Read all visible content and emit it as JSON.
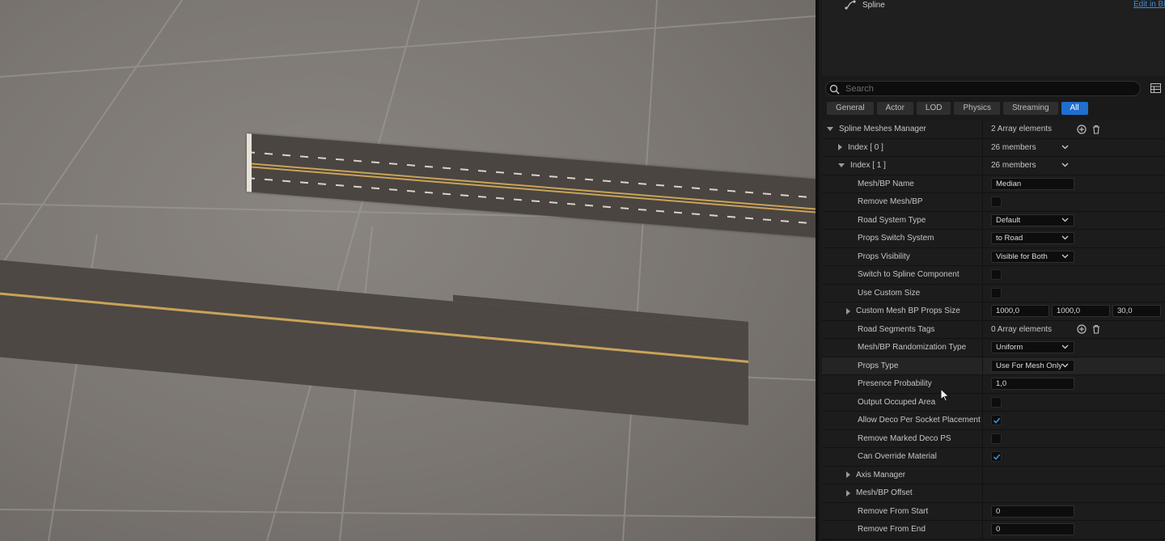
{
  "component": {
    "name": "Spline",
    "edit_link": "Edit in Blu"
  },
  "search": {
    "placeholder": "Search"
  },
  "tabs": [
    "General",
    "Actor",
    "LOD",
    "Physics",
    "Streaming",
    "All"
  ],
  "active_tab": "All",
  "rows": {
    "manager": {
      "label": "Spline Meshes Manager",
      "value": "2 Array elements"
    },
    "index0": {
      "label": "Index [ 0 ]",
      "value": "26 members"
    },
    "index1": {
      "label": "Index [ 1 ]",
      "value": "26 members"
    },
    "mesh_name": {
      "label": "Mesh/BP Name",
      "value": "Median"
    },
    "remove_mesh": {
      "label": "Remove Mesh/BP",
      "checked": false
    },
    "road_system_type": {
      "label": "Road System Type",
      "value": "Default"
    },
    "props_switch": {
      "label": "Props Switch System",
      "value": "to Road"
    },
    "props_visibility": {
      "label": "Props Visibility",
      "value": "Visible for Both"
    },
    "switch_spline": {
      "label": "Switch to Spline Component",
      "checked": false
    },
    "use_custom_size": {
      "label": "Use Custom Size",
      "checked": false
    },
    "custom_size": {
      "label": "Custom Mesh BP Props Size",
      "x": "1000,0",
      "y": "1000,0",
      "z": "30,0"
    },
    "road_tags": {
      "label": "Road Segments Tags",
      "value": "0 Array elements"
    },
    "randomization": {
      "label": "Mesh/BP Randomization Type",
      "value": "Uniform"
    },
    "props_type": {
      "label": "Props Type",
      "value": "Use For Mesh Only"
    },
    "presence": {
      "label": "Presence Probability",
      "value": "1,0"
    },
    "output_occupied": {
      "label": "Output Occuped Area",
      "checked": false
    },
    "allow_deco": {
      "label": "Allow Deco Per Socket Placement",
      "checked": true
    },
    "remove_marked": {
      "label": "Remove Marked Deco PS",
      "checked": false
    },
    "override_material": {
      "label": "Can Override Material",
      "checked": true
    },
    "axis_manager": {
      "label": "Axis Manager"
    },
    "mesh_offset": {
      "label": "Mesh/BP Offset"
    },
    "remove_start": {
      "label": "Remove From Start",
      "value": "0"
    },
    "remove_end": {
      "label": "Remove From End",
      "value": "0"
    }
  },
  "colors": {
    "accent": "#1f6fcf",
    "panel_bg": "#1a1a1a",
    "viewport_floor": "#7b7672",
    "road": "#4a4541",
    "road_line": "#c9a35a"
  },
  "icons": [
    "spline-icon",
    "search-icon",
    "grid-toggle-icon",
    "add-element-icon",
    "delete-array-icon",
    "chevron-down-icon",
    "checkmark-icon",
    "mouse-cursor-icon"
  ]
}
